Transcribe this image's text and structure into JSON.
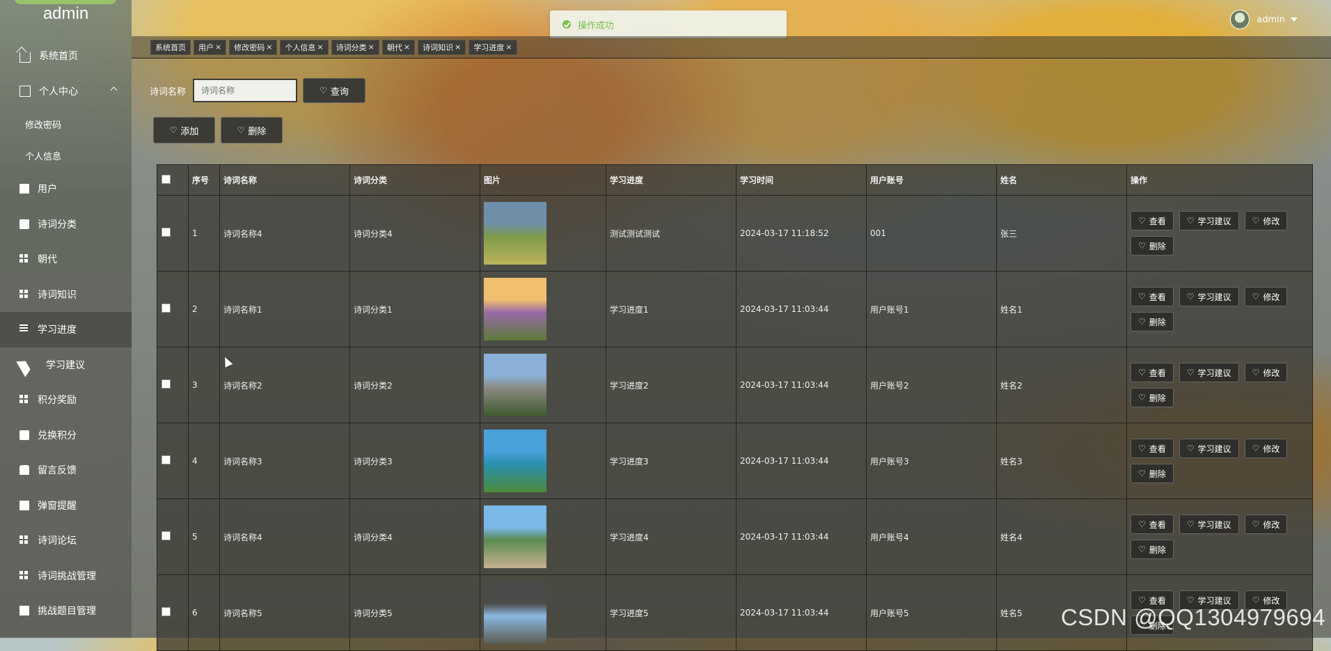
{
  "sidebar": {
    "title": "admin",
    "items": [
      {
        "label": "系统首页",
        "icon": "house-icon",
        "key": "home"
      },
      {
        "label": "个人中心",
        "icon": "box-icon",
        "key": "personal"
      },
      {
        "label": "修改密码",
        "key": "change-password",
        "sub": true
      },
      {
        "label": "个人信息",
        "key": "profile",
        "sub": true
      },
      {
        "label": "用户",
        "icon": "clipboard-icon",
        "key": "users"
      },
      {
        "label": "诗词分类",
        "icon": "chat-icon",
        "key": "poem-category"
      },
      {
        "label": "朝代",
        "icon": "grid-icon",
        "key": "dynasty"
      },
      {
        "label": "诗词知识",
        "icon": "grid-icon",
        "key": "poem-knowledge"
      },
      {
        "label": "学习进度",
        "icon": "list-icon",
        "key": "study-progress",
        "active": true
      },
      {
        "label": "学习建议",
        "icon": "send-icon",
        "key": "study-advice"
      },
      {
        "label": "积分奖励",
        "icon": "grid-icon",
        "key": "points-reward"
      },
      {
        "label": "兑换积分",
        "icon": "bag-icon",
        "key": "redeem-points"
      },
      {
        "label": "留言反馈",
        "icon": "hand-icon",
        "key": "feedback"
      },
      {
        "label": "弹窗提醒",
        "icon": "clipboard-icon",
        "key": "popup-reminder"
      },
      {
        "label": "诗词论坛",
        "icon": "grid-icon",
        "key": "forum"
      },
      {
        "label": "诗词挑战管理",
        "icon": "grid-icon",
        "key": "challenge-mgmt"
      },
      {
        "label": "挑战题目管理",
        "icon": "check-icon",
        "key": "question-mgmt"
      }
    ]
  },
  "topbar": {
    "toast": "操作成功",
    "username": "admin"
  },
  "tags": [
    "系统首页",
    "用户",
    "修改密码",
    "个人信息",
    "诗词分类",
    "朝代",
    "诗词知识",
    "学习进度"
  ],
  "search": {
    "label": "诗词名称",
    "placeholder": "诗词名称",
    "button": "查询"
  },
  "actions": {
    "add": "添加",
    "delete": "删除"
  },
  "table": {
    "headers": [
      "序号",
      "诗词名称",
      "诗词分类",
      "图片",
      "学习进度",
      "学习时间",
      "用户账号",
      "姓名",
      "操作"
    ],
    "rows": [
      {
        "no": "1",
        "name": "诗词名称4",
        "category": "诗词分类4",
        "progress": "测试测试测试",
        "time": "2024-03-17 11:18:52",
        "account": "001",
        "person": "张三",
        "img": [
          "#6f8fa8",
          "#7d9a4a",
          "#b9b35a"
        ]
      },
      {
        "no": "2",
        "name": "诗词名称1",
        "category": "诗词分类1",
        "progress": "学习进度1",
        "time": "2024-03-17 11:03:44",
        "account": "用户账号1",
        "person": "姓名1",
        "img": [
          "#f0c070",
          "#9a6aa8",
          "#5c7a3a"
        ]
      },
      {
        "no": "3",
        "name": "诗词名称2",
        "category": "诗词分类2",
        "progress": "学习进度2",
        "time": "2024-03-17 11:03:44",
        "account": "用户账号2",
        "person": "姓名2",
        "img": [
          "#8ab0d8",
          "#8a8a80",
          "#3f5a30"
        ]
      },
      {
        "no": "4",
        "name": "诗词名称3",
        "category": "诗词分类3",
        "progress": "学习进度3",
        "time": "2024-03-17 11:03:44",
        "account": "用户账号3",
        "person": "姓名3",
        "img": [
          "#4aa0d8",
          "#2a90b0",
          "#4e8a3a"
        ]
      },
      {
        "no": "5",
        "name": "诗词名称4",
        "category": "诗词分类4",
        "progress": "学习进度4",
        "time": "2024-03-17 11:03:44",
        "account": "用户账号4",
        "person": "姓名4",
        "img": [
          "#7ab8e8",
          "#5a8a50",
          "#c8b090"
        ]
      },
      {
        "no": "6",
        "name": "诗词名称5",
        "category": "诗词分类5",
        "progress": "学习进度5",
        "time": "2024-03-17 11:03:44",
        "account": "用户账号5",
        "person": "姓名5",
        "img": [
          "#4a4a48",
          "#8ab8e0",
          "#5a5a50"
        ]
      }
    ],
    "row_actions": [
      "查看",
      "学习建议",
      "修改",
      "删除"
    ]
  },
  "watermark": "CSDN @QQ1304979694"
}
